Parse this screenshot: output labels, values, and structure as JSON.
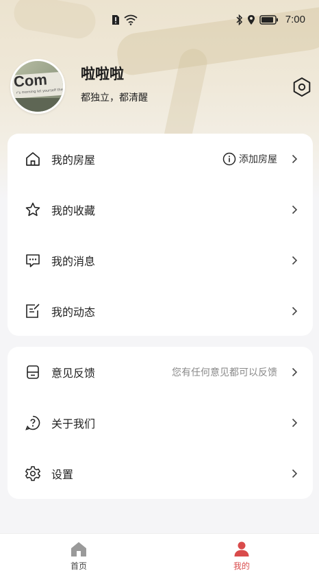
{
  "status_bar": {
    "time": "7:00",
    "icons": [
      "sim-alert-icon",
      "wifi-icon",
      "bluetooth-icon",
      "location-icon",
      "battery-icon"
    ]
  },
  "profile": {
    "name": "啦啦啦",
    "bio": "都独立，都清醒",
    "avatar_text": "Com",
    "avatar_subtext": "r's morning let yourself the very"
  },
  "menu_group_1": {
    "items": [
      {
        "label": "我的房屋",
        "icon": "house-icon",
        "extra": "添加房屋",
        "extra_icon": "info-circle-icon"
      },
      {
        "label": "我的收藏",
        "icon": "star-icon",
        "extra": ""
      },
      {
        "label": "我的消息",
        "icon": "message-icon",
        "extra": ""
      },
      {
        "label": "我的动态",
        "icon": "edit-note-icon",
        "extra": ""
      }
    ]
  },
  "menu_group_2": {
    "items": [
      {
        "label": "意见反馈",
        "icon": "feedback-icon",
        "extra": "您有任何意见都可以反馈"
      },
      {
        "label": "关于我们",
        "icon": "question-circle-icon",
        "extra": ""
      },
      {
        "label": "设置",
        "icon": "gear-icon",
        "extra": ""
      }
    ]
  },
  "tab_bar": {
    "home_label": "首页",
    "mine_label": "我的",
    "active_color": "#d94b4b",
    "inactive_color": "#444444"
  }
}
